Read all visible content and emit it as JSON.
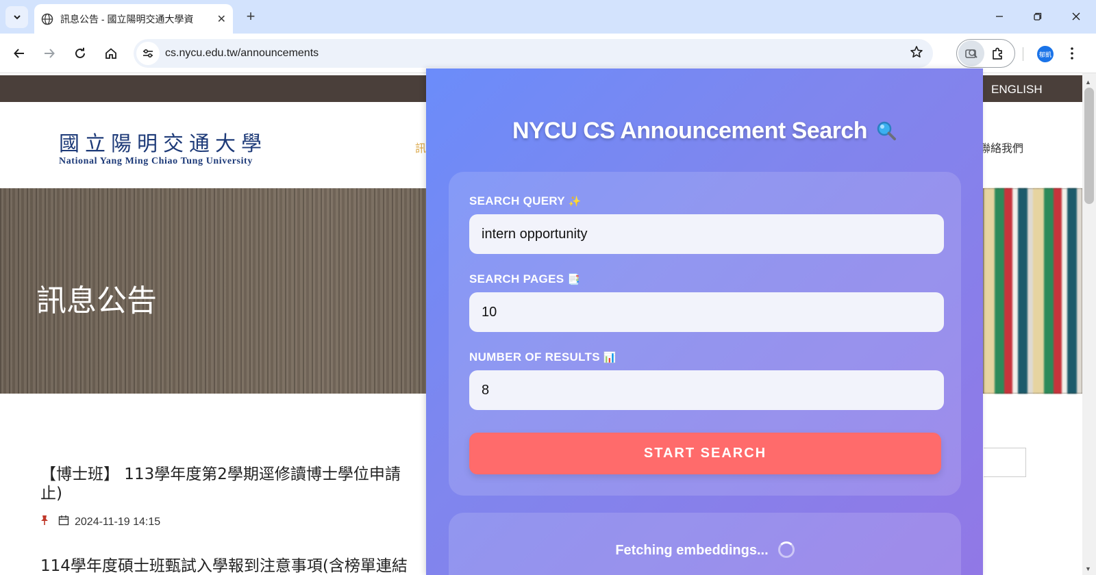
{
  "browser": {
    "tab_title": "訊息公告 - 國立陽明交通大學資",
    "url": "cs.nycu.edu.tw/announcements",
    "profile_initials": "郁凱"
  },
  "site": {
    "top_link": "ENGLISH",
    "logo_zh": "國立陽明交通大學",
    "logo_en": "National Yang Ming Chiao Tung University",
    "nav_left_partial": "訊",
    "nav_right_partial": "聯絡我們",
    "hero_title": "訊息公告",
    "announcements": [
      {
        "title": "【博士班】 113學年度第2學期逕修讀博士學位申請 止)",
        "date": "2024-11-19 14:15"
      },
      {
        "title": "114學年度碩士班甄試入學報到注意事項(含榜單連結"
      }
    ]
  },
  "popup": {
    "title": "NYCU CS Announcement Search",
    "fields": [
      {
        "label": "SEARCH QUERY",
        "emoji": "✨",
        "value": "intern opportunity"
      },
      {
        "label": "SEARCH PAGES",
        "emoji": "📑",
        "value": "10"
      },
      {
        "label": "NUMBER OF RESULTS",
        "emoji": "📊",
        "value": "8"
      }
    ],
    "button_label": "START SEARCH",
    "status_text": "Fetching embeddings..."
  },
  "colors": {
    "popup_gradient_start": "#6b8cfa",
    "popup_gradient_end": "#9178e6",
    "button": "#ff6b6b",
    "site_strip": "#4a3f3a",
    "logo": "#1d3a78"
  }
}
